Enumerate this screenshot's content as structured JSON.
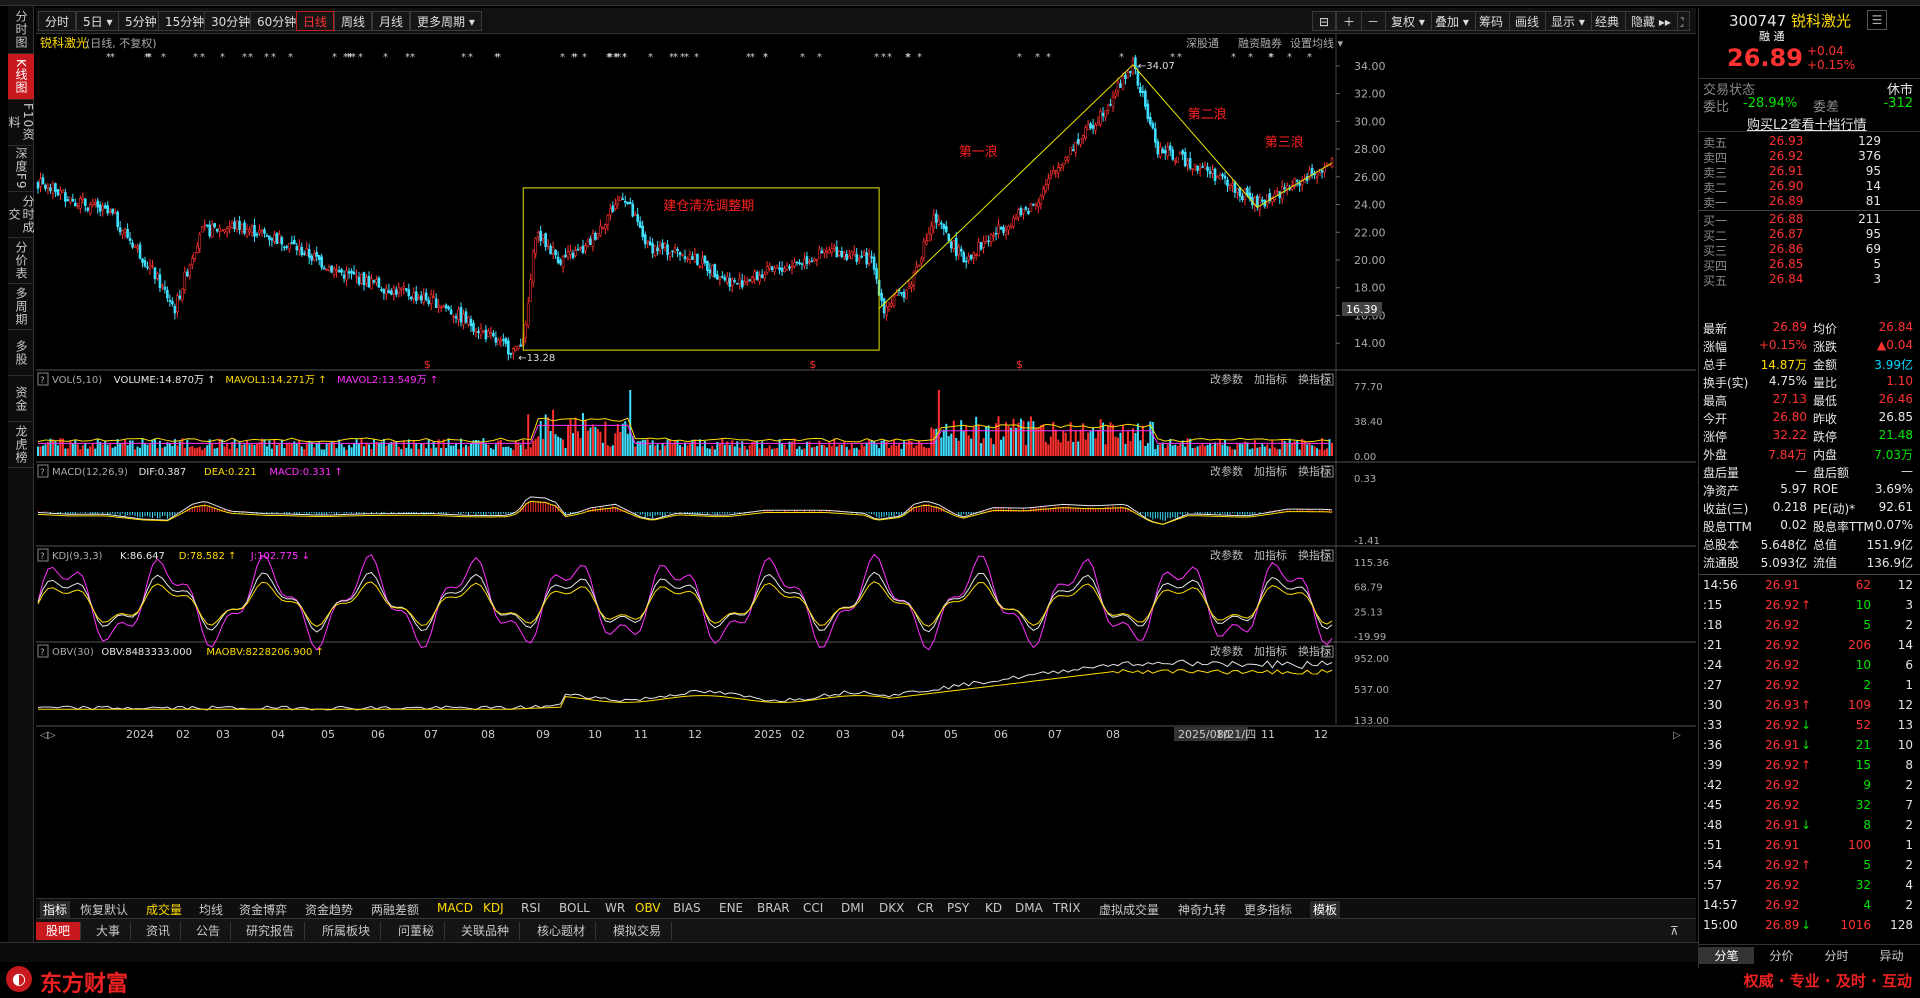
{
  "sidebar": [
    "分时图",
    "K线图",
    "F10资料",
    "深度F9",
    "分时成交",
    "分价表",
    "多周期",
    "多股",
    "资金",
    "龙虎榜"
  ],
  "toolbar": {
    "left": [
      "分时",
      "5日 ▾",
      "5分钟",
      "15分钟",
      "30分钟",
      "60分钟",
      "日线",
      "周线",
      "月线",
      "更多周期 ▾"
    ],
    "right": [
      "⊟",
      "＋",
      "－",
      "复权 ▾",
      "叠加 ▾",
      "筹码",
      "画线",
      "显示 ▾",
      "经典",
      "隐藏 ▸▸",
      "⛶"
    ],
    "active": "日线"
  },
  "kline": {
    "title": "锐科激光",
    "subtitle": "(日线, 不复权)",
    "links": [
      "深股通",
      "融资融券",
      "设置均线 ▾"
    ],
    "annotations": {
      "box_label": "建仓清洗调整期",
      "wave1": "第一浪",
      "wave2": "第二浪",
      "wave3": "第三浪",
      "high": "34.07",
      "low": "13.28"
    },
    "y_ticks": [
      "34.00",
      "32.00",
      "30.00",
      "28.00",
      "26.00",
      "24.00",
      "22.00",
      "20.00",
      "18.00",
      "16.00",
      "14.00"
    ],
    "last_price_tag": "16.39",
    "dollar_marks": [
      "$",
      "$",
      "$"
    ]
  },
  "panels": [
    {
      "id": "vol",
      "title": "VOL(5,10)",
      "items": [
        {
          "t": "VOLUME:14.870万 ↑",
          "c": "#e6e6e6"
        },
        {
          "t": "MAVOL1:14.271万 ↑",
          "c": "#ffdc00"
        },
        {
          "t": "MAVOL2:13.549万 ↑",
          "c": "#ff30ff"
        }
      ],
      "ticks": [
        "77.70",
        "38.40",
        "0.00"
      ]
    },
    {
      "id": "macd",
      "title": "MACD(12,26,9)",
      "items": [
        {
          "t": "DIF:0.387",
          "c": "#e6e6e6"
        },
        {
          "t": "DEA:0.221",
          "c": "#ffdc00"
        },
        {
          "t": "MACD:0.331 ↑",
          "c": "#ff30ff"
        }
      ],
      "ticks": [
        "0.33",
        "-1.41"
      ]
    },
    {
      "id": "kdj",
      "title": "KDJ(9,3,3)",
      "items": [
        {
          "t": "K:86.647",
          "c": "#e6e6e6"
        },
        {
          "t": "D:78.582 ↑",
          "c": "#ffdc00"
        },
        {
          "t": "J:102.775 ↓",
          "c": "#ff30ff"
        }
      ],
      "ticks": [
        "115.36",
        "68.79",
        "25.13",
        "-19.99"
      ]
    },
    {
      "id": "obv",
      "title": "OBV(30)",
      "items": [
        {
          "t": "OBV:8483333.000",
          "c": "#e6e6e6"
        },
        {
          "t": "MAOBV:8228206.900 ↑",
          "c": "#ffdc00"
        }
      ],
      "ticks": [
        "952.00",
        "537.00",
        "133.00"
      ]
    }
  ],
  "panel_buttons": [
    "改参数",
    "加指标",
    "换指标"
  ],
  "xaxis": [
    "2024",
    "02",
    "03",
    "04",
    "05",
    "06",
    "07",
    "08",
    "09",
    "10",
    "11",
    "12",
    "2025",
    "02",
    "03",
    "04",
    "05",
    "06",
    "07",
    "08",
    "2025/08/21/四",
    "10",
    "11",
    "12"
  ],
  "indicator_tabs": [
    "指标",
    "恢复默认",
    "成交量",
    "均线",
    "资金博弈",
    "资金趋势",
    "两融差额",
    "MACD",
    "KDJ",
    "RSI",
    "BOLL",
    "WR",
    "OBV",
    "BIAS",
    "ENE",
    "BRAR",
    "CCI",
    "DMI",
    "DKX",
    "CR",
    "PSY",
    "KD",
    "DMA",
    "TRIX",
    "虚拟成交量",
    "神奇九转",
    "更多指标",
    "模板"
  ],
  "bottom_tabs": [
    "股吧",
    "大事",
    "资讯",
    "公告",
    "研究报告",
    "所属板块",
    "问董秘",
    "关联品种",
    "核心题材",
    "模拟交易"
  ],
  "quote": {
    "code": "300747",
    "name": "锐科激光",
    "badges": "融 通",
    "price": "26.89",
    "change": "+0.04",
    "pct": "+0.15%",
    "trade_state_label": "交易状态",
    "trade_state": "休市",
    "weibi_label": "委比",
    "weibi": "-28.94%",
    "weicha_label": "委差",
    "weicha": "-312",
    "l2_link": "购买L2查看十档行情",
    "asks": [
      {
        "l": "卖五",
        "p": "26.93",
        "v": "129"
      },
      {
        "l": "卖四",
        "p": "26.92",
        "v": "376"
      },
      {
        "l": "卖三",
        "p": "26.91",
        "v": "95"
      },
      {
        "l": "卖二",
        "p": "26.90",
        "v": "14"
      },
      {
        "l": "卖一",
        "p": "26.89",
        "v": "81"
      }
    ],
    "bids": [
      {
        "l": "买一",
        "p": "26.88",
        "v": "211"
      },
      {
        "l": "买二",
        "p": "26.87",
        "v": "95"
      },
      {
        "l": "买三",
        "p": "26.86",
        "v": "69"
      },
      {
        "l": "买四",
        "p": "26.85",
        "v": "5"
      },
      {
        "l": "买五",
        "p": "26.84",
        "v": "3"
      }
    ],
    "stats": [
      {
        "a": "最新",
        "b": "26.89",
        "bc": "red",
        "c": "均价",
        "d": "26.84",
        "dc": "red"
      },
      {
        "a": "涨幅",
        "b": "+0.15%",
        "bc": "red",
        "c": "涨跌",
        "d": "▲0.04",
        "dc": "red"
      },
      {
        "a": "总手",
        "b": "14.87万",
        "bc": "yellow",
        "c": "金额",
        "d": "3.99亿",
        "dc": "cyan"
      },
      {
        "a": "换手(实)",
        "b": "4.75%",
        "bc": "white",
        "c": "量比",
        "d": "1.10",
        "dc": "red"
      },
      {
        "a": "最高",
        "b": "27.13",
        "bc": "red",
        "c": "最低",
        "d": "26.46",
        "dc": "red"
      },
      {
        "a": "今开",
        "b": "26.80",
        "bc": "red",
        "c": "昨收",
        "d": "26.85",
        "dc": "white"
      },
      {
        "a": "涨停",
        "b": "32.22",
        "bc": "red",
        "c": "跌停",
        "d": "21.48",
        "dc": "green"
      },
      {
        "a": "外盘",
        "b": "7.84万",
        "bc": "red",
        "c": "内盘",
        "d": "7.03万",
        "dc": "green"
      },
      {
        "a": "盘后量",
        "b": "—",
        "bc": "white",
        "c": "盘后额",
        "d": "—",
        "dc": "white"
      },
      {
        "a": "净资产",
        "b": "5.97",
        "bc": "white",
        "c": "ROE",
        "d": "3.69%",
        "dc": "white"
      },
      {
        "a": "收益(三)",
        "b": "0.218",
        "bc": "white",
        "c": "PE(动)*",
        "d": "92.61",
        "dc": "white"
      },
      {
        "a": "股息TTM",
        "b": "0.02",
        "bc": "white",
        "c": "股息率TTM",
        "d": "0.07%",
        "dc": "white"
      },
      {
        "a": "总股本",
        "b": "5.648亿",
        "bc": "white",
        "c": "总值",
        "d": "151.9亿",
        "dc": "white"
      },
      {
        "a": "流通股",
        "b": "5.093亿",
        "bc": "white",
        "c": "流值",
        "d": "136.9亿",
        "dc": "white"
      }
    ],
    "ticks": [
      {
        "t": "14:56",
        "p": "26.91",
        "pa": "",
        "v": "62",
        "n": "12"
      },
      {
        "t": ":15",
        "p": "26.92",
        "pa": "↑",
        "v": "10",
        "n": "3"
      },
      {
        "t": ":18",
        "p": "26.92",
        "pa": "",
        "v": "5",
        "n": "2"
      },
      {
        "t": ":21",
        "p": "26.92",
        "pa": "",
        "v": "206",
        "n": "14"
      },
      {
        "t": ":24",
        "p": "26.92",
        "pa": "",
        "v": "10",
        "n": "6"
      },
      {
        "t": ":27",
        "p": "26.92",
        "pa": "",
        "v": "2",
        "n": "1"
      },
      {
        "t": ":30",
        "p": "26.93",
        "pa": "↑",
        "v": "109",
        "n": "12"
      },
      {
        "t": ":33",
        "p": "26.92",
        "pa": "↓",
        "v": "52",
        "n": "13"
      },
      {
        "t": ":36",
        "p": "26.91",
        "pa": "↓",
        "v": "21",
        "n": "10"
      },
      {
        "t": ":39",
        "p": "26.92",
        "pa": "↑",
        "v": "15",
        "n": "8"
      },
      {
        "t": ":42",
        "p": "26.92",
        "pa": "",
        "v": "9",
        "n": "2"
      },
      {
        "t": ":45",
        "p": "26.92",
        "pa": "",
        "v": "32",
        "n": "7"
      },
      {
        "t": ":48",
        "p": "26.91",
        "pa": "↓",
        "v": "8",
        "n": "2"
      },
      {
        "t": ":51",
        "p": "26.91",
        "pa": "",
        "v": "100",
        "n": "1"
      },
      {
        "t": ":54",
        "p": "26.92",
        "pa": "↑",
        "v": "5",
        "n": "2"
      },
      {
        "t": ":57",
        "p": "26.92",
        "pa": "",
        "v": "32",
        "n": "4"
      },
      {
        "t": "14:57",
        "p": "26.92",
        "pa": "",
        "v": "4",
        "n": "2"
      },
      {
        "t": "15:00",
        "p": "26.89",
        "pa": "↓",
        "v": "1016",
        "n": "128"
      }
    ],
    "bottom_tabs": [
      "分笔",
      "分价",
      "分时",
      "异动"
    ]
  },
  "footer": {
    "logo": "东方财富",
    "slogan": "权威 · 专业 · 及时 · 互动"
  }
}
